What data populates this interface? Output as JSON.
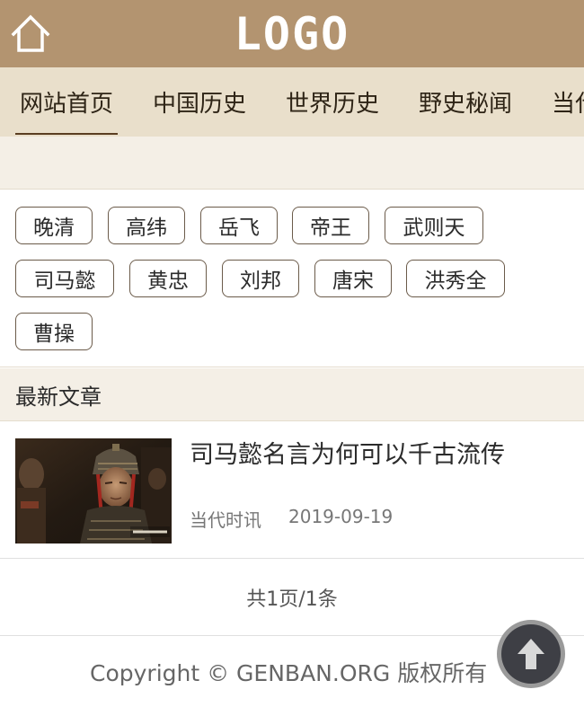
{
  "header": {
    "logo_text": "LOGO",
    "home_icon": "home-icon",
    "background": "#b39470"
  },
  "nav": {
    "items": [
      {
        "label": "网站首页",
        "active": true
      },
      {
        "label": "中国历史",
        "active": false
      },
      {
        "label": "世界历史",
        "active": false
      },
      {
        "label": "野史秘闻",
        "active": false
      },
      {
        "label": "当代",
        "active": false
      }
    ],
    "background": "#e9dfcb"
  },
  "tags": [
    "晚清",
    "高纬",
    "岳飞",
    "帝王",
    "武则天",
    "司马懿",
    "黄忠",
    "刘邦",
    "唐宋",
    "洪秀全",
    "曹操"
  ],
  "section": {
    "title": "最新文章"
  },
  "articles": [
    {
      "title": "司马懿名言为何可以千古流传",
      "category": "当代时讯",
      "date": "2019-09-19",
      "thumbnail": "armored-general-photo"
    }
  ],
  "pager": {
    "text": "共1页/1条"
  },
  "footer": {
    "copyright": "Copyright © GENBAN.ORG 版权所有"
  },
  "back_to_top": {
    "icon": "arrow-up-icon"
  }
}
